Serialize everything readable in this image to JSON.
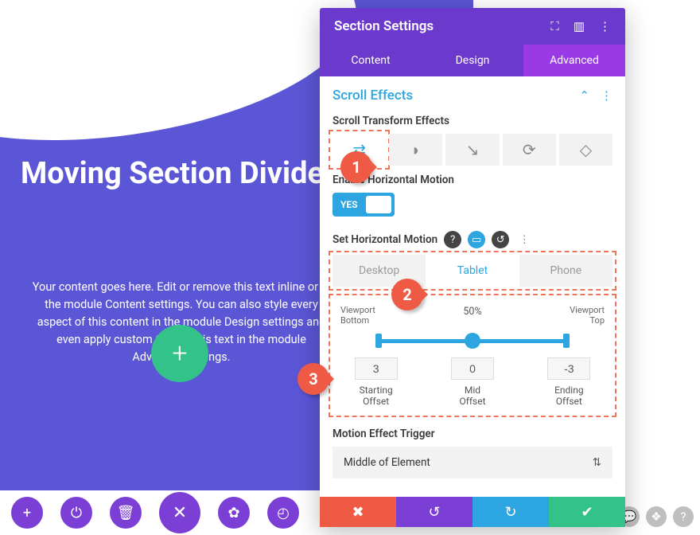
{
  "hero": {
    "title": "Moving Section Divider",
    "copy": "Your content goes here. Edit or remove this text inline or in the module Content settings. You can also style every aspect of this content in the module Design settings and even apply custom CSS to this text in the module Advanced settings."
  },
  "panel": {
    "title": "Section Settings",
    "tabs": {
      "content": "Content",
      "design": "Design",
      "advanced": "Advanced"
    },
    "section": "Scroll Effects",
    "scroll_transform_label": "Scroll Transform Effects",
    "enable_horizontal_label": "Enable Horizontal Motion",
    "toggle_yes": "YES",
    "set_horizontal_label": "Set Horizontal Motion",
    "device_tabs": {
      "desktop": "Desktop",
      "tablet": "Tablet",
      "phone": "Phone"
    },
    "range": {
      "percent": "50%",
      "viewport_bottom": "Viewport\nBottom",
      "viewport_top": "Viewport\nTop",
      "start": "3",
      "mid": "0",
      "end": "-3",
      "start_label": "Starting\nOffset",
      "mid_label": "Mid\nOffset",
      "end_label": "Ending\nOffset"
    },
    "trigger_label": "Motion Effect Trigger",
    "trigger_value": "Middle of Element"
  },
  "callouts": {
    "c1": "1",
    "c2": "2",
    "c3": "3"
  }
}
